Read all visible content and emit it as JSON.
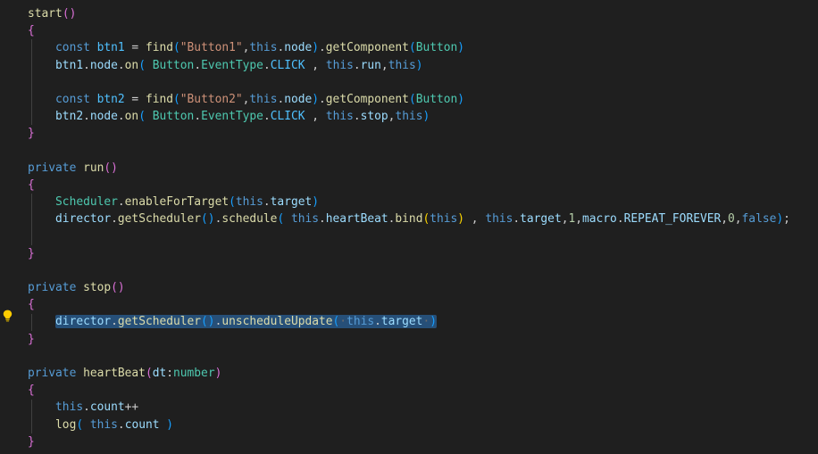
{
  "editor": {
    "colors": {
      "background": "#1f1f1f",
      "keyword": "#569cd6",
      "function": "#dcdcaa",
      "string": "#ce9178",
      "variable": "#9cdcfe",
      "class": "#4ec9b0",
      "constant": "#4fc1ff",
      "number": "#b5cea8",
      "bracket_level1": "#ffd700",
      "bracket_level2": "#da70d6",
      "bracket_level3": "#179fff",
      "selection": "#264f78"
    },
    "gutter": {
      "lightbulb_icon": "lightbulb-icon"
    },
    "lines": [
      {
        "tokens": [
          {
            "t": "start",
            "c": "fn"
          },
          {
            "t": "()",
            "c": "b2"
          }
        ]
      },
      {
        "tokens": [
          {
            "t": "{",
            "c": "b2"
          }
        ]
      },
      {
        "tokens": [
          {
            "t": "    ",
            "c": "pl"
          },
          {
            "t": "const",
            "c": "kw"
          },
          {
            "t": " ",
            "c": "pl"
          },
          {
            "t": "btn1",
            "c": "cst"
          },
          {
            "t": " = ",
            "c": "pl"
          },
          {
            "t": "find",
            "c": "fn"
          },
          {
            "t": "(",
            "c": "b3"
          },
          {
            "t": "\"Button1\"",
            "c": "str"
          },
          {
            "t": ",",
            "c": "pl"
          },
          {
            "t": "this",
            "c": "kw"
          },
          {
            "t": ".",
            "c": "pl"
          },
          {
            "t": "node",
            "c": "var"
          },
          {
            "t": ")",
            "c": "b3"
          },
          {
            "t": ".",
            "c": "pl"
          },
          {
            "t": "getComponent",
            "c": "fn"
          },
          {
            "t": "(",
            "c": "b3"
          },
          {
            "t": "Button",
            "c": "cls"
          },
          {
            "t": ")",
            "c": "b3"
          }
        ]
      },
      {
        "tokens": [
          {
            "t": "    ",
            "c": "pl"
          },
          {
            "t": "btn1",
            "c": "var"
          },
          {
            "t": ".",
            "c": "pl"
          },
          {
            "t": "node",
            "c": "var"
          },
          {
            "t": ".",
            "c": "pl"
          },
          {
            "t": "on",
            "c": "fn"
          },
          {
            "t": "(",
            "c": "b3"
          },
          {
            "t": " ",
            "c": "pl"
          },
          {
            "t": "Button",
            "c": "cls"
          },
          {
            "t": ".",
            "c": "pl"
          },
          {
            "t": "EventType",
            "c": "cls"
          },
          {
            "t": ".",
            "c": "pl"
          },
          {
            "t": "CLICK",
            "c": "cst"
          },
          {
            "t": " , ",
            "c": "pl"
          },
          {
            "t": "this",
            "c": "kw"
          },
          {
            "t": ".",
            "c": "pl"
          },
          {
            "t": "run",
            "c": "var"
          },
          {
            "t": ",",
            "c": "pl"
          },
          {
            "t": "this",
            "c": "kw"
          },
          {
            "t": ")",
            "c": "b3"
          }
        ]
      },
      {
        "tokens": []
      },
      {
        "tokens": [
          {
            "t": "    ",
            "c": "pl"
          },
          {
            "t": "const",
            "c": "kw"
          },
          {
            "t": " ",
            "c": "pl"
          },
          {
            "t": "btn2",
            "c": "cst"
          },
          {
            "t": " = ",
            "c": "pl"
          },
          {
            "t": "find",
            "c": "fn"
          },
          {
            "t": "(",
            "c": "b3"
          },
          {
            "t": "\"Button2\"",
            "c": "str"
          },
          {
            "t": ",",
            "c": "pl"
          },
          {
            "t": "this",
            "c": "kw"
          },
          {
            "t": ".",
            "c": "pl"
          },
          {
            "t": "node",
            "c": "var"
          },
          {
            "t": ")",
            "c": "b3"
          },
          {
            "t": ".",
            "c": "pl"
          },
          {
            "t": "getComponent",
            "c": "fn"
          },
          {
            "t": "(",
            "c": "b3"
          },
          {
            "t": "Button",
            "c": "cls"
          },
          {
            "t": ")",
            "c": "b3"
          }
        ]
      },
      {
        "tokens": [
          {
            "t": "    ",
            "c": "pl"
          },
          {
            "t": "btn2",
            "c": "var"
          },
          {
            "t": ".",
            "c": "pl"
          },
          {
            "t": "node",
            "c": "var"
          },
          {
            "t": ".",
            "c": "pl"
          },
          {
            "t": "on",
            "c": "fn"
          },
          {
            "t": "(",
            "c": "b3"
          },
          {
            "t": " ",
            "c": "pl"
          },
          {
            "t": "Button",
            "c": "cls"
          },
          {
            "t": ".",
            "c": "pl"
          },
          {
            "t": "EventType",
            "c": "cls"
          },
          {
            "t": ".",
            "c": "pl"
          },
          {
            "t": "CLICK",
            "c": "cst"
          },
          {
            "t": " , ",
            "c": "pl"
          },
          {
            "t": "this",
            "c": "kw"
          },
          {
            "t": ".",
            "c": "pl"
          },
          {
            "t": "stop",
            "c": "var"
          },
          {
            "t": ",",
            "c": "pl"
          },
          {
            "t": "this",
            "c": "kw"
          },
          {
            "t": ")",
            "c": "b3"
          }
        ]
      },
      {
        "tokens": [
          {
            "t": "}",
            "c": "b2"
          }
        ]
      },
      {
        "tokens": []
      },
      {
        "tokens": [
          {
            "t": "private",
            "c": "kw"
          },
          {
            "t": " ",
            "c": "pl"
          },
          {
            "t": "run",
            "c": "fn"
          },
          {
            "t": "()",
            "c": "b2"
          }
        ]
      },
      {
        "tokens": [
          {
            "t": "{",
            "c": "b2"
          }
        ]
      },
      {
        "tokens": [
          {
            "t": "    ",
            "c": "pl"
          },
          {
            "t": "Scheduler",
            "c": "cls"
          },
          {
            "t": ".",
            "c": "pl"
          },
          {
            "t": "enableForTarget",
            "c": "fn"
          },
          {
            "t": "(",
            "c": "b3"
          },
          {
            "t": "this",
            "c": "kw"
          },
          {
            "t": ".",
            "c": "pl"
          },
          {
            "t": "target",
            "c": "var"
          },
          {
            "t": ")",
            "c": "b3"
          }
        ]
      },
      {
        "tokens": [
          {
            "t": "    ",
            "c": "pl"
          },
          {
            "t": "director",
            "c": "var"
          },
          {
            "t": ".",
            "c": "pl"
          },
          {
            "t": "getScheduler",
            "c": "fn"
          },
          {
            "t": "()",
            "c": "b3"
          },
          {
            "t": ".",
            "c": "pl"
          },
          {
            "t": "schedule",
            "c": "fn"
          },
          {
            "t": "(",
            "c": "b3"
          },
          {
            "t": " ",
            "c": "pl"
          },
          {
            "t": "this",
            "c": "kw"
          },
          {
            "t": ".",
            "c": "pl"
          },
          {
            "t": "heartBeat",
            "c": "var"
          },
          {
            "t": ".",
            "c": "pl"
          },
          {
            "t": "bind",
            "c": "fn"
          },
          {
            "t": "(",
            "c": "b1"
          },
          {
            "t": "this",
            "c": "kw"
          },
          {
            "t": ")",
            "c": "b1"
          },
          {
            "t": " , ",
            "c": "pl"
          },
          {
            "t": "this",
            "c": "kw"
          },
          {
            "t": ".",
            "c": "pl"
          },
          {
            "t": "target",
            "c": "var"
          },
          {
            "t": ",",
            "c": "pl"
          },
          {
            "t": "1",
            "c": "num"
          },
          {
            "t": ",",
            "c": "pl"
          },
          {
            "t": "macro",
            "c": "var"
          },
          {
            "t": ".",
            "c": "pl"
          },
          {
            "t": "REPEAT_FOREVER",
            "c": "var"
          },
          {
            "t": ",",
            "c": "pl"
          },
          {
            "t": "0",
            "c": "num"
          },
          {
            "t": ",",
            "c": "pl"
          },
          {
            "t": "false",
            "c": "kw"
          },
          {
            "t": ")",
            "c": "b3"
          },
          {
            "t": ";",
            "c": "pl"
          }
        ]
      },
      {
        "tokens": []
      },
      {
        "tokens": [
          {
            "t": "}",
            "c": "b2"
          }
        ]
      },
      {
        "tokens": []
      },
      {
        "tokens": [
          {
            "t": "private",
            "c": "kw"
          },
          {
            "t": " ",
            "c": "pl"
          },
          {
            "t": "stop",
            "c": "fn"
          },
          {
            "t": "()",
            "c": "b2"
          }
        ]
      },
      {
        "tokens": [
          {
            "t": "{",
            "c": "b2"
          }
        ]
      },
      {
        "selected": true,
        "tokens": [
          {
            "t": "    ",
            "c": "pl"
          },
          {
            "t": "director",
            "c": "var",
            "s": 1
          },
          {
            "t": ".",
            "c": "pl",
            "s": 1
          },
          {
            "t": "getScheduler",
            "c": "fn",
            "s": 1
          },
          {
            "t": "()",
            "c": "b3",
            "s": 1
          },
          {
            "t": ".",
            "c": "pl",
            "s": 1
          },
          {
            "t": "unscheduleUpdate",
            "c": "fn",
            "s": 1
          },
          {
            "t": "(",
            "c": "b3",
            "s": 1
          },
          {
            "t": "·",
            "c": "ws",
            "s": 1
          },
          {
            "t": "this",
            "c": "kw",
            "s": 1
          },
          {
            "t": ".",
            "c": "pl",
            "s": 1
          },
          {
            "t": "target",
            "c": "var",
            "s": 1
          },
          {
            "t": "·",
            "c": "ws",
            "s": 1
          },
          {
            "t": ")",
            "c": "b3",
            "s": 1
          }
        ]
      },
      {
        "tokens": [
          {
            "t": "}",
            "c": "b2"
          }
        ]
      },
      {
        "tokens": []
      },
      {
        "tokens": [
          {
            "t": "private",
            "c": "kw"
          },
          {
            "t": " ",
            "c": "pl"
          },
          {
            "t": "heartBeat",
            "c": "fn"
          },
          {
            "t": "(",
            "c": "b2"
          },
          {
            "t": "dt",
            "c": "var"
          },
          {
            "t": ":",
            "c": "pl"
          },
          {
            "t": "number",
            "c": "cls"
          },
          {
            "t": ")",
            "c": "b2"
          }
        ]
      },
      {
        "tokens": [
          {
            "t": "{",
            "c": "b2"
          }
        ]
      },
      {
        "tokens": [
          {
            "t": "    ",
            "c": "pl"
          },
          {
            "t": "this",
            "c": "kw"
          },
          {
            "t": ".",
            "c": "pl"
          },
          {
            "t": "count",
            "c": "var"
          },
          {
            "t": "++",
            "c": "pl"
          }
        ]
      },
      {
        "tokens": [
          {
            "t": "    ",
            "c": "pl"
          },
          {
            "t": "log",
            "c": "fn"
          },
          {
            "t": "(",
            "c": "b3"
          },
          {
            "t": " ",
            "c": "pl"
          },
          {
            "t": "this",
            "c": "kw"
          },
          {
            "t": ".",
            "c": "pl"
          },
          {
            "t": "count",
            "c": "var"
          },
          {
            "t": " ",
            "c": "pl"
          },
          {
            "t": ")",
            "c": "b3"
          }
        ]
      },
      {
        "tokens": [
          {
            "t": "}",
            "c": "b2"
          }
        ]
      }
    ]
  }
}
